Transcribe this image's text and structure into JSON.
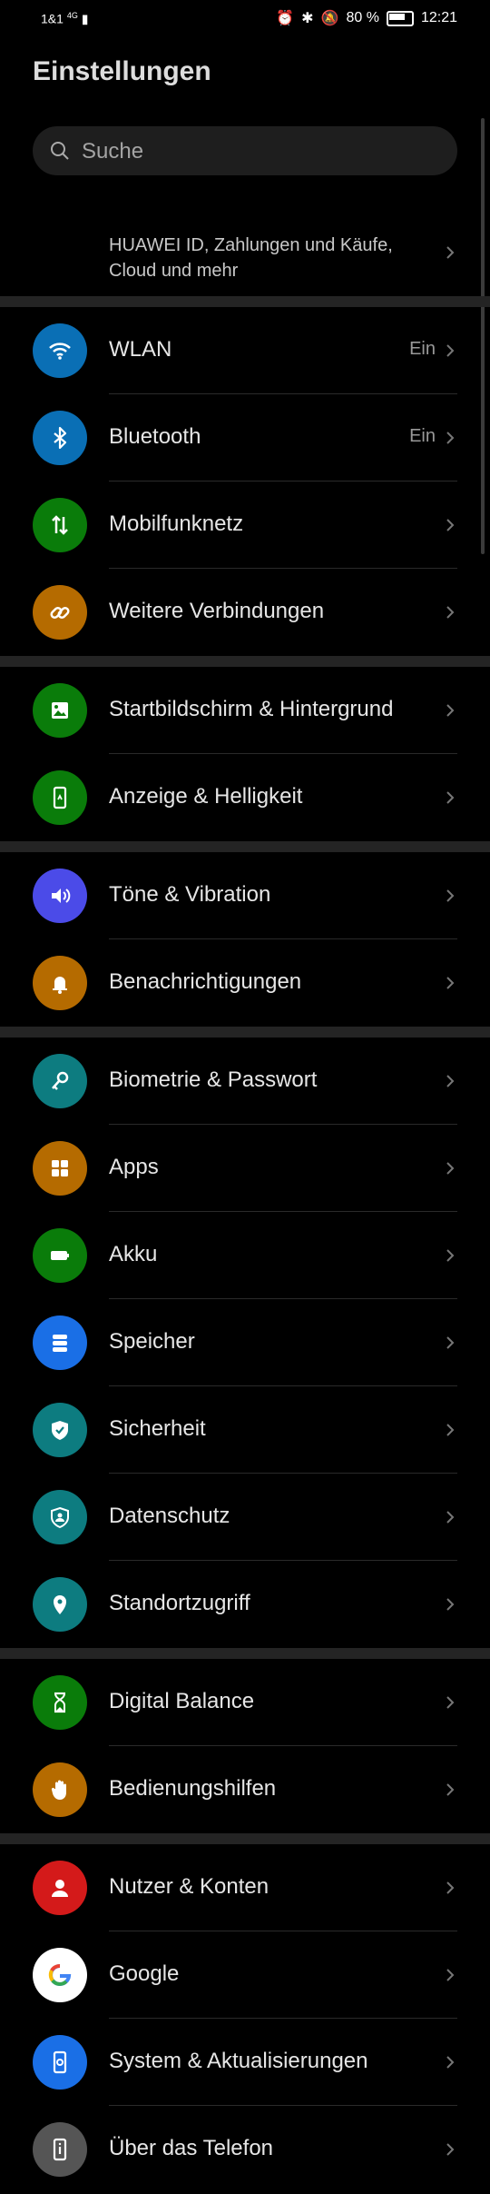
{
  "status_bar": {
    "carrier": "1&1",
    "network": "4G",
    "battery": "80 %",
    "time": "12:21"
  },
  "header": {
    "title": "Einstellungen"
  },
  "search": {
    "placeholder": "Suche"
  },
  "account": {
    "label": "HUAWEI ID, Zahlungen und Käufe, Cloud und mehr"
  },
  "items": [
    {
      "label": "WLAN",
      "value": "Ein",
      "icon": "wifi-icon",
      "color": "#0a6fb5"
    },
    {
      "label": "Bluetooth",
      "value": "Ein",
      "icon": "bluetooth-icon",
      "color": "#0a6fb5"
    },
    {
      "label": "Mobilfunknetz",
      "icon": "mobile-data-icon",
      "color": "#0a7c0a"
    },
    {
      "label": "Weitere Verbindungen",
      "icon": "link-icon",
      "color": "#b56b00"
    },
    {
      "label": "Startbildschirm & Hintergrund",
      "icon": "image-icon",
      "color": "#0a7c0a"
    },
    {
      "label": "Anzeige & Helligkeit",
      "icon": "display-icon",
      "color": "#0a7c0a"
    },
    {
      "label": "Töne & Vibration",
      "icon": "speaker-icon",
      "color": "#4b4be8"
    },
    {
      "label": "Benachrichtigungen",
      "icon": "bell-icon",
      "color": "#b56b00"
    },
    {
      "label": "Biometrie & Passwort",
      "icon": "key-icon",
      "color": "#0d7c80"
    },
    {
      "label": "Apps",
      "icon": "apps-icon",
      "color": "#b56b00"
    },
    {
      "label": "Akku",
      "icon": "battery-icon",
      "color": "#0a7c0a"
    },
    {
      "label": "Speicher",
      "icon": "storage-icon",
      "color": "#1a6fe6"
    },
    {
      "label": "Sicherheit",
      "icon": "shield-check-icon",
      "color": "#0d7c80"
    },
    {
      "label": "Datenschutz",
      "icon": "privacy-icon",
      "color": "#0d7c80"
    },
    {
      "label": "Standortzugriff",
      "icon": "location-icon",
      "color": "#0d7c80"
    },
    {
      "label": "Digital Balance",
      "icon": "hourglass-icon",
      "color": "#0a7c0a"
    },
    {
      "label": "Bedienungshilfen",
      "icon": "hand-icon",
      "color": "#b56b00"
    },
    {
      "label": "Nutzer & Konten",
      "icon": "user-icon",
      "color": "#d41a1a"
    },
    {
      "label": "Google",
      "icon": "google-icon",
      "color": "#ffffff"
    },
    {
      "label": "System & Aktualisierungen",
      "icon": "system-update-icon",
      "color": "#1a6fe6"
    },
    {
      "label": "Über das Telefon",
      "icon": "phone-info-icon",
      "color": "#555555"
    }
  ]
}
